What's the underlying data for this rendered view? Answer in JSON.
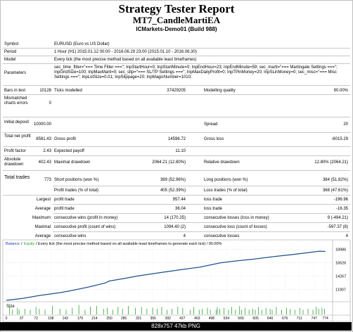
{
  "report": {
    "title": "Strategy Tester Report",
    "expert": "MT7_CandleMartiEA",
    "server": "ICMarkets-Demo01 (Build 988)"
  },
  "labels": {
    "symbol": "Symbol",
    "period": "Period",
    "model": "Model",
    "parameters": "Parameters",
    "bars_in_test": "Bars in test",
    "mismatched": "Mismatched charts errors",
    "initial_deposit": "Initial deposit",
    "total_net_profit": "Total net profit",
    "profit_factor": "Profit factor",
    "absolute_drawdown": "Absolute drawdown",
    "total_trades": "Total trades",
    "ticks_modelled": "Ticks modelled",
    "modelling_quality": "Modelling quality",
    "spread": "Spread",
    "gross_profit": "Gross profit",
    "gross_loss": "Gross loss",
    "expected_payoff": "Expected payoff",
    "maximal_drawdown": "Maximal drawdown",
    "relative_drawdown": "Relative drawdown",
    "short_positions": "Short positions (won %)",
    "long_positions": "Long positions (won %)",
    "profit_trades": "Profit trades (% of total)",
    "loss_trades": "Loss trades (% of total)",
    "largest": "Largest",
    "average": "Average",
    "maximum": "Maximum",
    "maximal": "Maximal",
    "profit_trade": "profit trade",
    "loss_trade": "loss trade",
    "cons_wins_money": "consecutive wins (profit in money)",
    "cons_losses_money": "consecutive losses (loss in money)",
    "cons_profit_count": "consecutive profit (count of wins)",
    "cons_loss_count": "consecutive loss (count of losses)",
    "cons_wins": "consecutive wins",
    "cons_losses": "consecutive losses"
  },
  "values": {
    "symbol": "EURUSD (Euro vs US Dollar)",
    "period": "1 Hour (H1) 2015.01.12 00:00 - 2016.06.29 23:00 (2015.01.10 - 2016.06.30)",
    "model": "Every tick (the most precise method based on all available least timeframes)",
    "parameters": "sec_time_filter=\"=== Time Filter ===\"; InpStartHour=0; InpStartMinute=0; InpEndHour=23; InpEndMinute=59; sec_marti=\"=== Martingale Settings ===\"; InpGridSize=100; InpMaxMarti=0; sec_sltp=\"=== SL/TP Settings ===\"; InpMaxDailyProfit=0; InpTPinMoney=20; InpSLinMoney=0; sec_misc=\"=== Misc Settings ===\"; InpLotSize=0.01; InpSlippage=20; InpMagicNumber=1010;",
    "bars_in_test": "10128",
    "ticks_modelled": "37429205",
    "modelling_quality": "90.00%",
    "mismatched": "0",
    "initial_deposit": "10000.00",
    "spread": "20",
    "total_net_profit": "8581.43",
    "gross_profit": "14596.72",
    "gross_loss": "-6015.29",
    "profit_factor": "2.43",
    "expected_payoff": "11.10",
    "absolute_drawdown": "402.43",
    "maximal_drawdown": "2064.21 (12.80%)",
    "relative_drawdown": "12.80% (2064.21)",
    "total_trades": "773",
    "short_positions": "389 (52.96%)",
    "long_positions": "384 (51.82%)",
    "profit_trades": "405 (52.39%)",
    "loss_trades": "368 (47.61%)",
    "largest_profit": "957.44",
    "largest_loss": "-196.96",
    "average_profit": "36.04",
    "average_loss": "-16.35",
    "max_cons_wins": "14 (170.25)",
    "max_cons_losses": "9 (-494.21)",
    "maximal_cons_profit": "1094.40 (2)",
    "maximal_cons_loss": "-597.37 (8)",
    "average_cons_wins": "4",
    "average_cons_losses": "4"
  },
  "chart": {
    "legend_balance": "Balance",
    "legend_sep": "/",
    "legend_equity": "Equity",
    "legend_rest": "/ Every tick (the most precise method based on all available least timeframes to generate each tick) / 90.00%",
    "size_label": "Size",
    "balance_color": "#1f3fa0",
    "equity_color": "#2ca22c",
    "volume_color": "#2ca22c"
  },
  "chart_data": {
    "type": "line",
    "yticks": [
      11907,
      14267,
      16626,
      18986
    ],
    "ylim": [
      10000,
      19400
    ],
    "xticks": [
      0,
      37,
      72,
      108,
      143,
      179,
      214,
      250,
      285,
      321,
      356,
      392,
      427,
      463,
      498,
      534,
      569,
      605,
      640,
      676,
      711,
      747,
      774
    ],
    "xlim": [
      0,
      790
    ],
    "series": [
      {
        "name": "Balance",
        "x": [
          0,
          40,
          80,
          100,
          130,
          160,
          200,
          240,
          250,
          290,
          320,
          380,
          430,
          470,
          520,
          560,
          600,
          650,
          700,
          760,
          774
        ],
        "y": [
          10000,
          10350,
          10850,
          11050,
          11350,
          11750,
          12350,
          13050,
          13400,
          13900,
          14300,
          14950,
          15450,
          15850,
          16600,
          16950,
          17250,
          17700,
          18100,
          18650,
          18600
        ]
      }
    ],
    "size_bars": [
      [
        8,
        11
      ],
      [
        15,
        5
      ],
      [
        27,
        7
      ],
      [
        31,
        5
      ],
      [
        45,
        6
      ],
      [
        58,
        5
      ],
      [
        72,
        8
      ],
      [
        80,
        6
      ],
      [
        94,
        5
      ],
      [
        112,
        9
      ],
      [
        130,
        6
      ],
      [
        145,
        5
      ],
      [
        160,
        7
      ],
      [
        176,
        10
      ],
      [
        191,
        5
      ],
      [
        204,
        8
      ],
      [
        219,
        9
      ],
      [
        236,
        6
      ],
      [
        245,
        7
      ],
      [
        258,
        5
      ],
      [
        271,
        8
      ],
      [
        282,
        6
      ],
      [
        296,
        9
      ],
      [
        313,
        7
      ],
      [
        328,
        8
      ],
      [
        341,
        6
      ],
      [
        355,
        7
      ],
      [
        366,
        6
      ],
      [
        377,
        8
      ],
      [
        390,
        5
      ],
      [
        402,
        6
      ],
      [
        416,
        8
      ],
      [
        428,
        7
      ],
      [
        446,
        5
      ],
      [
        455,
        8
      ],
      [
        468,
        5
      ],
      [
        475,
        6
      ],
      [
        488,
        7
      ],
      [
        495,
        5
      ],
      [
        509,
        5
      ],
      [
        512,
        8
      ],
      [
        518,
        6
      ],
      [
        528,
        7
      ],
      [
        539,
        5
      ],
      [
        547,
        8
      ],
      [
        556,
        5
      ],
      [
        566,
        9
      ],
      [
        571,
        5
      ],
      [
        579,
        7
      ],
      [
        589,
        5
      ],
      [
        598,
        6
      ],
      [
        604,
        5
      ],
      [
        612,
        8
      ],
      [
        620,
        5
      ],
      [
        630,
        7
      ],
      [
        640,
        6
      ],
      [
        645,
        5
      ],
      [
        655,
        8
      ],
      [
        668,
        5
      ],
      [
        680,
        7
      ],
      [
        689,
        6
      ],
      [
        700,
        5
      ],
      [
        712,
        7
      ],
      [
        720,
        5
      ],
      [
        732,
        6
      ],
      [
        744,
        5
      ],
      [
        752,
        8
      ],
      [
        758,
        6
      ],
      [
        766,
        7
      ],
      [
        772,
        6
      ]
    ],
    "size_ylim": [
      0,
      12
    ]
  },
  "footer": {
    "text": "828x757  47kb  PNG"
  }
}
